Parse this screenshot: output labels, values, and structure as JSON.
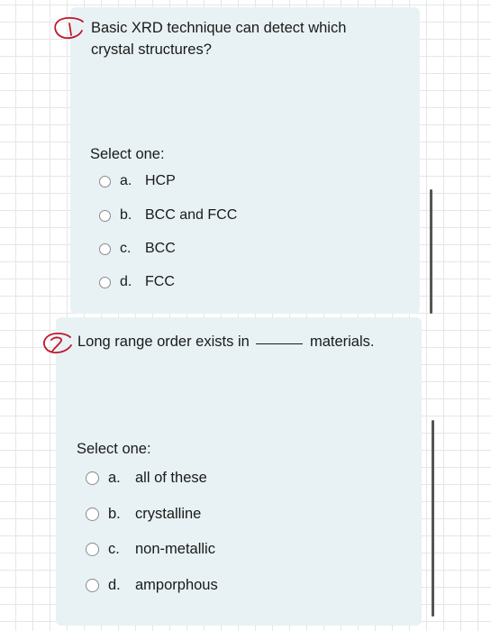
{
  "q1": {
    "mark": "1",
    "text": "Basic XRD technique can detect which crystal structures?",
    "select_label": "Select one:",
    "options": [
      {
        "letter": "a.",
        "label": "HCP"
      },
      {
        "letter": "b.",
        "label": "BCC and FCC"
      },
      {
        "letter": "c.",
        "label": "BCC"
      },
      {
        "letter": "d.",
        "label": "FCC"
      }
    ]
  },
  "q2": {
    "mark": "2",
    "text_before": "Long range order exists in",
    "text_after": "materials.",
    "select_label": "Select one:",
    "options": [
      {
        "letter": "a.",
        "label": "all of these"
      },
      {
        "letter": "b.",
        "label": "crystalline"
      },
      {
        "letter": "c.",
        "label": "non-metallic"
      },
      {
        "letter": "d.",
        "label": "amporphous"
      }
    ]
  },
  "colors": {
    "card_bg": "#e8f2f4",
    "annotation_red": "#c0182b",
    "grid": "#e6e6e6"
  }
}
